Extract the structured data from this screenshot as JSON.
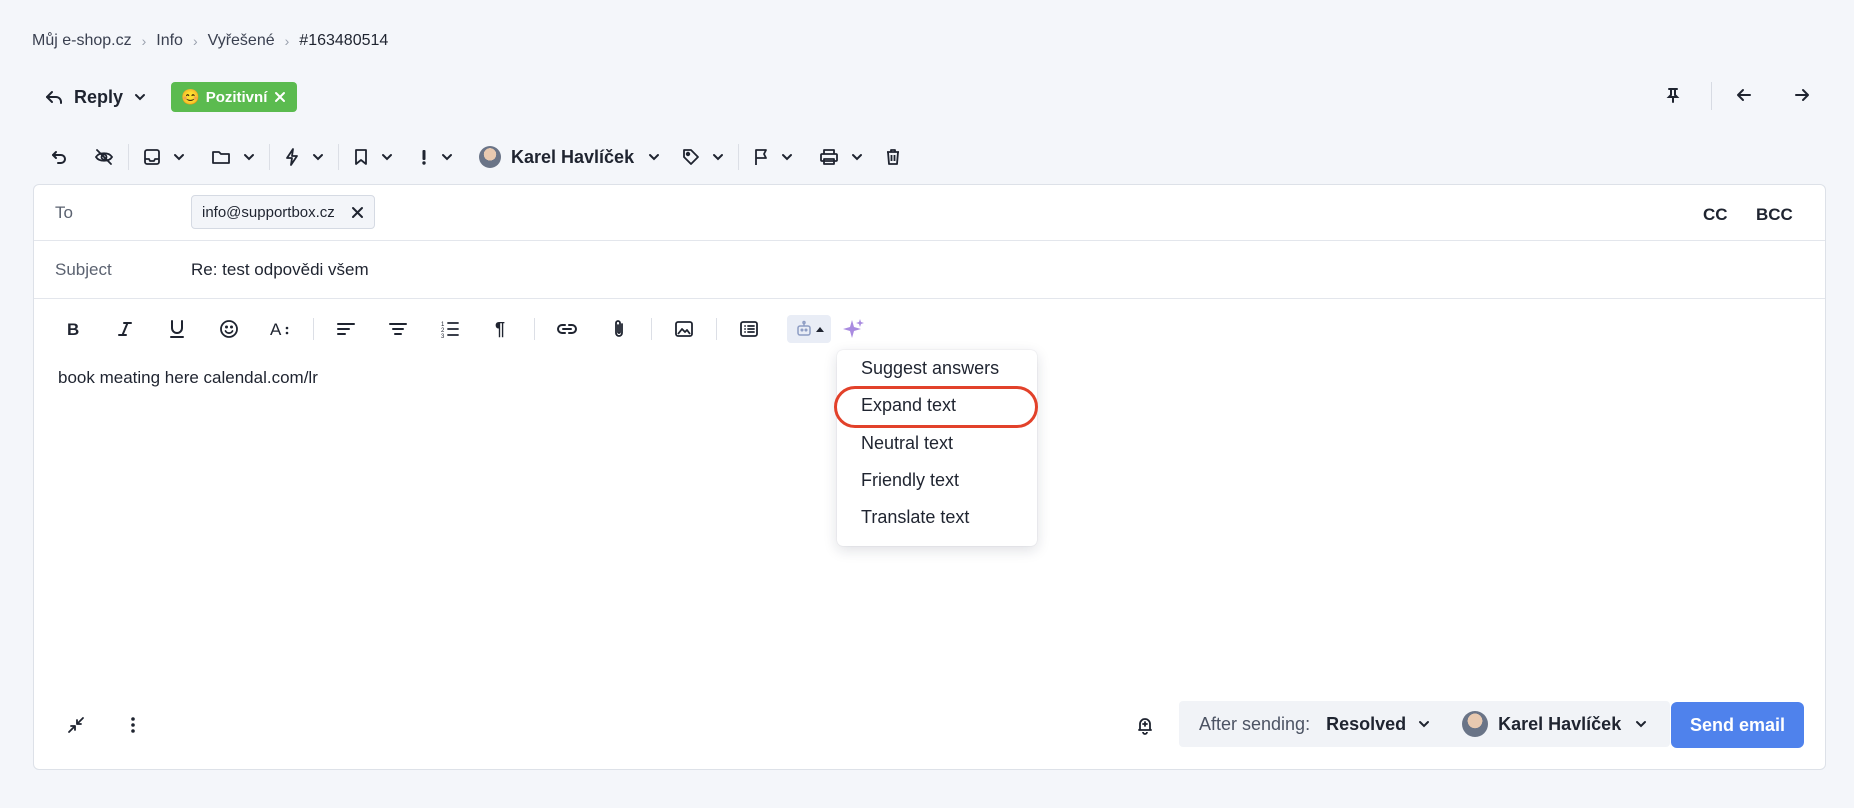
{
  "breadcrumb": [
    "Můj e-shop.cz",
    "Info",
    "Vyřešené",
    "#163480514"
  ],
  "header": {
    "reply_label": "Reply",
    "sentiment_badge": "Pozitivní",
    "sentiment_emoji": "😊"
  },
  "toolbar": {
    "assignee": "Karel Havlíček",
    "icons": [
      "undo-icon",
      "eye-off-icon",
      "inbox-icon",
      "folder-icon",
      "lightning-icon",
      "bookmark-icon",
      "priority-icon",
      "tag-icon",
      "flag-icon",
      "print-icon",
      "trash-icon"
    ]
  },
  "compose": {
    "to_label": "To",
    "to_recipient": "info@supportbox.cz",
    "cc_label": "CC",
    "bcc_label": "BCC",
    "subject_label": "Subject",
    "subject_value": "Re: test odpovědi všem",
    "body": "book meating here calendal.com/lr"
  },
  "ai_menu": {
    "items": [
      "Suggest answers",
      "Expand text",
      "Neutral text",
      "Friendly text",
      "Translate text"
    ],
    "highlighted": "Expand text"
  },
  "footer": {
    "after_sending_label": "After sending:",
    "after_sending_value": "Resolved",
    "assignee": "Karel Havlíček",
    "send_label": "Send email"
  },
  "colors": {
    "accent": "#4f82ec",
    "badge_green": "#5bbb4f",
    "highlight_red": "#e2412a"
  }
}
